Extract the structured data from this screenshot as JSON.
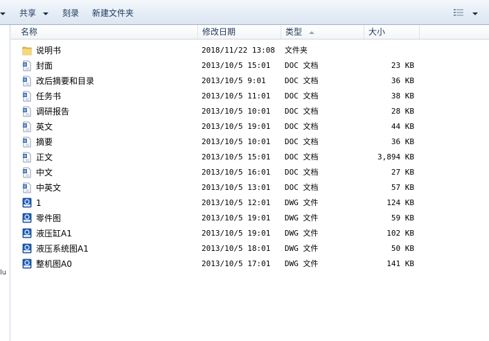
{
  "toolbar": {
    "share_label": "共享",
    "burn_label": "刻录",
    "new_folder_label": "新建文件夹"
  },
  "nav": {
    "partial_text": "lu"
  },
  "columns": {
    "name": "名称",
    "modified": "修改日期",
    "type": "类型",
    "size": "大小"
  },
  "files": [
    {
      "name": "说明书",
      "date": "2018/11/22 13:08",
      "type": "文件夹",
      "size": "",
      "icon": "folder-icon"
    },
    {
      "name": "封面",
      "date": "2013/10/5 15:01",
      "type": "DOC 文档",
      "size": "23 KB",
      "icon": "doc-icon"
    },
    {
      "name": "改后摘要和目录",
      "date": "2013/10/5 9:01",
      "type": "DOC 文档",
      "size": "36 KB",
      "icon": "doc-icon"
    },
    {
      "name": "任务书",
      "date": "2013/10/5 11:01",
      "type": "DOC 文档",
      "size": "38 KB",
      "icon": "doc-icon"
    },
    {
      "name": "调研报告",
      "date": "2013/10/5 10:01",
      "type": "DOC 文档",
      "size": "28 KB",
      "icon": "doc-icon"
    },
    {
      "name": "英文",
      "date": "2013/10/5 19:01",
      "type": "DOC 文档",
      "size": "44 KB",
      "icon": "doc-icon"
    },
    {
      "name": "摘要",
      "date": "2013/10/5 10:01",
      "type": "DOC 文档",
      "size": "36 KB",
      "icon": "doc-icon"
    },
    {
      "name": "正文",
      "date": "2013/10/5 15:01",
      "type": "DOC 文档",
      "size": "3,894 KB",
      "icon": "doc-icon"
    },
    {
      "name": "中文",
      "date": "2013/10/5 16:01",
      "type": "DOC 文档",
      "size": "27 KB",
      "icon": "doc-icon"
    },
    {
      "name": "中英文",
      "date": "2013/10/5 13:01",
      "type": "DOC 文档",
      "size": "57 KB",
      "icon": "doc-icon"
    },
    {
      "name": "1",
      "date": "2013/10/5 12:01",
      "type": "DWG 文件",
      "size": "124 KB",
      "icon": "dwg-icon"
    },
    {
      "name": "零件图",
      "date": "2013/10/5 19:01",
      "type": "DWG 文件",
      "size": "59 KB",
      "icon": "dwg-icon"
    },
    {
      "name": "液压缸A1",
      "date": "2013/10/5 19:01",
      "type": "DWG 文件",
      "size": "102 KB",
      "icon": "dwg-icon"
    },
    {
      "name": "液压系统图A1",
      "date": "2013/10/5 18:01",
      "type": "DWG 文件",
      "size": "50 KB",
      "icon": "dwg-icon"
    },
    {
      "name": "整机图A0",
      "date": "2013/10/5 17:01",
      "type": "DWG 文件",
      "size": "141 KB",
      "icon": "dwg-icon"
    }
  ]
}
